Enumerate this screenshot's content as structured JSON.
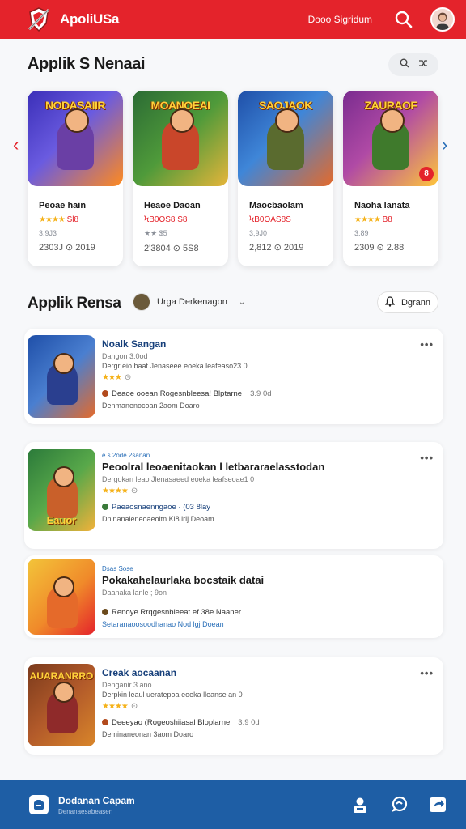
{
  "header": {
    "app_name": "ApoliUSa",
    "top_link": "Dooo Sigridum",
    "logo_icon": "sword-shield-logo",
    "search_icon": "search-icon",
    "avatar_icon": "user-avatar"
  },
  "featured": {
    "title": "Applik S Nenaai",
    "prev_arrow": "‹",
    "next_arrow": "›",
    "cards": [
      {
        "art_title": "NODASAIIR",
        "name": "Peoae hain",
        "stars": "★★★★",
        "rating": " Sl8",
        "meta": "3.9J3",
        "stats": "2303J    ⊙ 2019",
        "bg": "#3b2fb8",
        "bg2": "#ff8a1e",
        "hero": "#6a3fa5"
      },
      {
        "art_title": "MOANOEAI",
        "name": "Heaoe Daoan",
        "stars": "",
        "rating": "ϞB0OS8 S8",
        "meta": "★★ $5",
        "stats": "2'3804    ⊙ 5S8",
        "bg": "#2b6b34",
        "bg2": "#e6b53a",
        "hero": "#c9462a"
      },
      {
        "art_title": "SAOJAOK",
        "name": "Maocbaolam",
        "stars": "",
        "rating": "ϞB0OAS8S",
        "meta": "3,9J0",
        "stats": "2,812    ⊙ 2019",
        "bg": "#1f4fa8",
        "bg2": "#e56a2a",
        "hero": "#5a6b2f"
      },
      {
        "art_title": "ZAURAOF",
        "name": "Naoha lanata",
        "stars": "★★★★",
        "rating": " B8",
        "meta": "3.89",
        "stats": "2309    ⊙ 2.88",
        "bg": "#7a2c8f",
        "bg2": "#ffc63a",
        "hero": "#3f7a2c"
      }
    ]
  },
  "list": {
    "title": "Applik Rensa",
    "filter_label": "Urga Derkenagon",
    "filter_chevron": "⌄",
    "button_label": "Dgrann",
    "rows": [
      {
        "kicker": "",
        "title": "Noalk Sangan",
        "sub": "Dangon 3.0od",
        "desc": "Dergr eio baat Jenaseee eoeka leafeaso23.0",
        "stars": "★★★",
        "dev": "Deaoe ooean Rogesnbleesa!  Blptarne",
        "size": "3.9 0d",
        "foot": "Denmanenocoan 2aom Doaro",
        "art_title": "",
        "bg": "#1f4fa8",
        "bg2": "#e56a2a",
        "hero": "#2a3f8f"
      },
      {
        "kicker": "e   s  2ode  2sanan",
        "title": "Peoolral leoaenitaokan l letbararaelasstodan",
        "sub": "Dergokan leao Jlenasaeed eoeka leafseoae1 0",
        "desc": "",
        "stars": "★★★★",
        "dev": "Paeaosnaenngaoe  ·  (03 8lay",
        "size": "",
        "foot": "Dninanaleneoaeoitn Ki8 lrlj Deoam",
        "art_title": "Eauor",
        "bg": "#2b7a3a",
        "bg2": "#f3b23a",
        "hero": "#c9602a"
      },
      {
        "kicker": "Dsas    Sose",
        "title": "Pokakahelaurlaka bocstaik datai",
        "sub": "Daanaka lanle  ;  9on",
        "desc": "",
        "stars": "",
        "dev": "Renoye Rrqgesnbieeat ef 38e Naaner",
        "size": "",
        "foot": "Setaranaoosoodhanao Nod lgj Doean",
        "art_title": "",
        "bg": "#f3c53a",
        "bg2": "#e4232b",
        "hero": "#e56a2a"
      },
      {
        "kicker": "",
        "title": "Creak aocaanan",
        "sub": "Denganir 3.ano",
        "desc": "Derpkin leaul ueratepoa eoeka lleanse an 0",
        "stars": "★★★★",
        "dev": "Deeeyao (Rogeoshiiasal  Bloplarne",
        "size": "3.9 0d",
        "foot": "Deminaneonan 3aom Doaro",
        "art_title": "AUARANRRO",
        "bg": "#7a3a1c",
        "bg2": "#d9862a",
        "hero": "#8f2a2a"
      }
    ]
  },
  "footer": {
    "title": "Dodanan Capam",
    "subtitle": "Denanaesabeasen"
  }
}
